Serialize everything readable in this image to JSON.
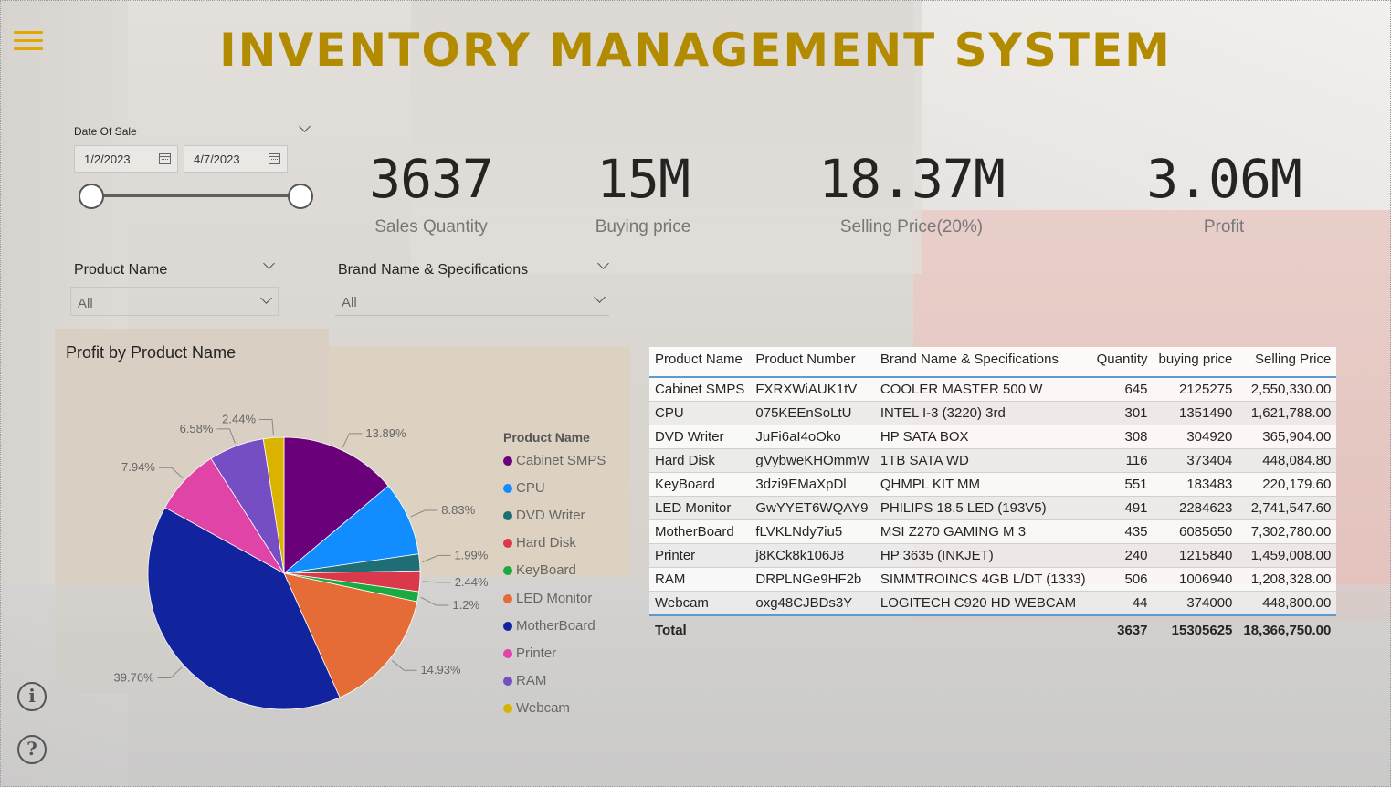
{
  "title": "INVENTORY MANAGEMENT SYSTEM",
  "date_slicer": {
    "label": "Date Of Sale",
    "start": "1/2/2023",
    "end": "4/7/2023"
  },
  "product_slicer": {
    "label": "Product Name",
    "value": "All"
  },
  "brand_slicer": {
    "label": "Brand Name & Specifications",
    "value": "All"
  },
  "kpis": [
    {
      "value": "3637",
      "label": "Sales Quantity"
    },
    {
      "value": "15M",
      "label": "Buying price"
    },
    {
      "value": "18.37M",
      "label": "Selling Price(20%)"
    },
    {
      "value": "3.06M",
      "label": "Profit"
    }
  ],
  "chart_data": {
    "type": "pie",
    "title": "Profit by Product Name",
    "legend_title": "Product Name",
    "legend_position": "right",
    "categories": [
      "Cabinet SMPS",
      "CPU",
      "DVD Writer",
      "Hard Disk",
      "KeyBoard",
      "LED Monitor",
      "MotherBoard",
      "Printer",
      "RAM",
      "Webcam"
    ],
    "slices": [
      {
        "name": "Cabinet SMPS",
        "value": 13.89,
        "label": "13.89%",
        "color": "#6b007b"
      },
      {
        "name": "CPU",
        "value": 8.83,
        "label": "8.83%",
        "color": "#118dff"
      },
      {
        "name": "DVD Writer",
        "value": 1.99,
        "label": "1.99%",
        "color": "#1f6e75"
      },
      {
        "name": "Hard Disk",
        "value": 2.44,
        "label": "2.44%",
        "color": "#d9394b"
      },
      {
        "name": "KeyBoard",
        "value": 1.2,
        "label": "1.2%",
        "color": "#1aab40"
      },
      {
        "name": "LED Monitor",
        "value": 14.93,
        "label": "14.93%",
        "color": "#e66c37"
      },
      {
        "name": "MotherBoard",
        "value": 39.76,
        "label": "39.76%",
        "color": "#12239e"
      },
      {
        "name": "Printer",
        "value": 7.94,
        "label": "7.94%",
        "color": "#e044a7"
      },
      {
        "name": "RAM",
        "value": 6.58,
        "label": "6.58%",
        "color": "#744ec2"
      },
      {
        "name": "Webcam",
        "value": 2.44,
        "label": "2.44%",
        "color": "#d9b300"
      }
    ]
  },
  "table": {
    "headers": [
      "Product Name",
      "Product Number",
      "Brand Name & Specifications",
      "Quantity",
      "buying price",
      "Selling Price"
    ],
    "rows": [
      [
        "Cabinet SMPS",
        "FXRXWiAUK1tV",
        "COOLER MASTER 500 W",
        "645",
        "2125275",
        "2,550,330.00"
      ],
      [
        "CPU",
        "075KEEnSoLtU",
        "INTEL I-3 (3220) 3rd",
        "301",
        "1351490",
        "1,621,788.00"
      ],
      [
        "DVD Writer",
        "JuFi6aI4oOko",
        "HP SATA BOX",
        "308",
        "304920",
        "365,904.00"
      ],
      [
        "Hard Disk",
        "gVybweKHOmmW",
        "1TB SATA WD",
        "116",
        "373404",
        "448,084.80"
      ],
      [
        "KeyBoard",
        "3dzi9EMaXpDl",
        "QHMPL KIT MM",
        "551",
        "183483",
        "220,179.60"
      ],
      [
        "LED Monitor",
        "GwYYET6WQAY9",
        "PHILIPS 18.5 LED (193V5)",
        "491",
        "2284623",
        "2,741,547.60"
      ],
      [
        "MotherBoard",
        "fLVKLNdy7iu5",
        "MSI Z270 GAMING M 3",
        "435",
        "6085650",
        "7,302,780.00"
      ],
      [
        "Printer",
        "j8KCk8k106J8",
        "HP 3635 (INKJET)",
        "240",
        "1215840",
        "1,459,008.00"
      ],
      [
        "RAM",
        "DRPLNGe9HF2b",
        "SIMMTROINCS 4GB L/DT (1333)",
        "506",
        "1006940",
        "1,208,328.00"
      ],
      [
        "Webcam",
        "oxg48CJBDs3Y",
        "LOGITECH C920 HD WEBCAM",
        "44",
        "374000",
        "448,800.00"
      ]
    ],
    "total": [
      "Total",
      "",
      "",
      "3637",
      "15305625",
      "18,366,750.00"
    ]
  },
  "icons": {
    "menu": "hamburger-menu-icon",
    "info": "info-icon",
    "help": "help-icon",
    "info_glyph": "i",
    "help_glyph": "?"
  },
  "colors": {
    "title": "#b38b00",
    "menu": "#e2a800",
    "table_accent": "#5b9bd5"
  }
}
